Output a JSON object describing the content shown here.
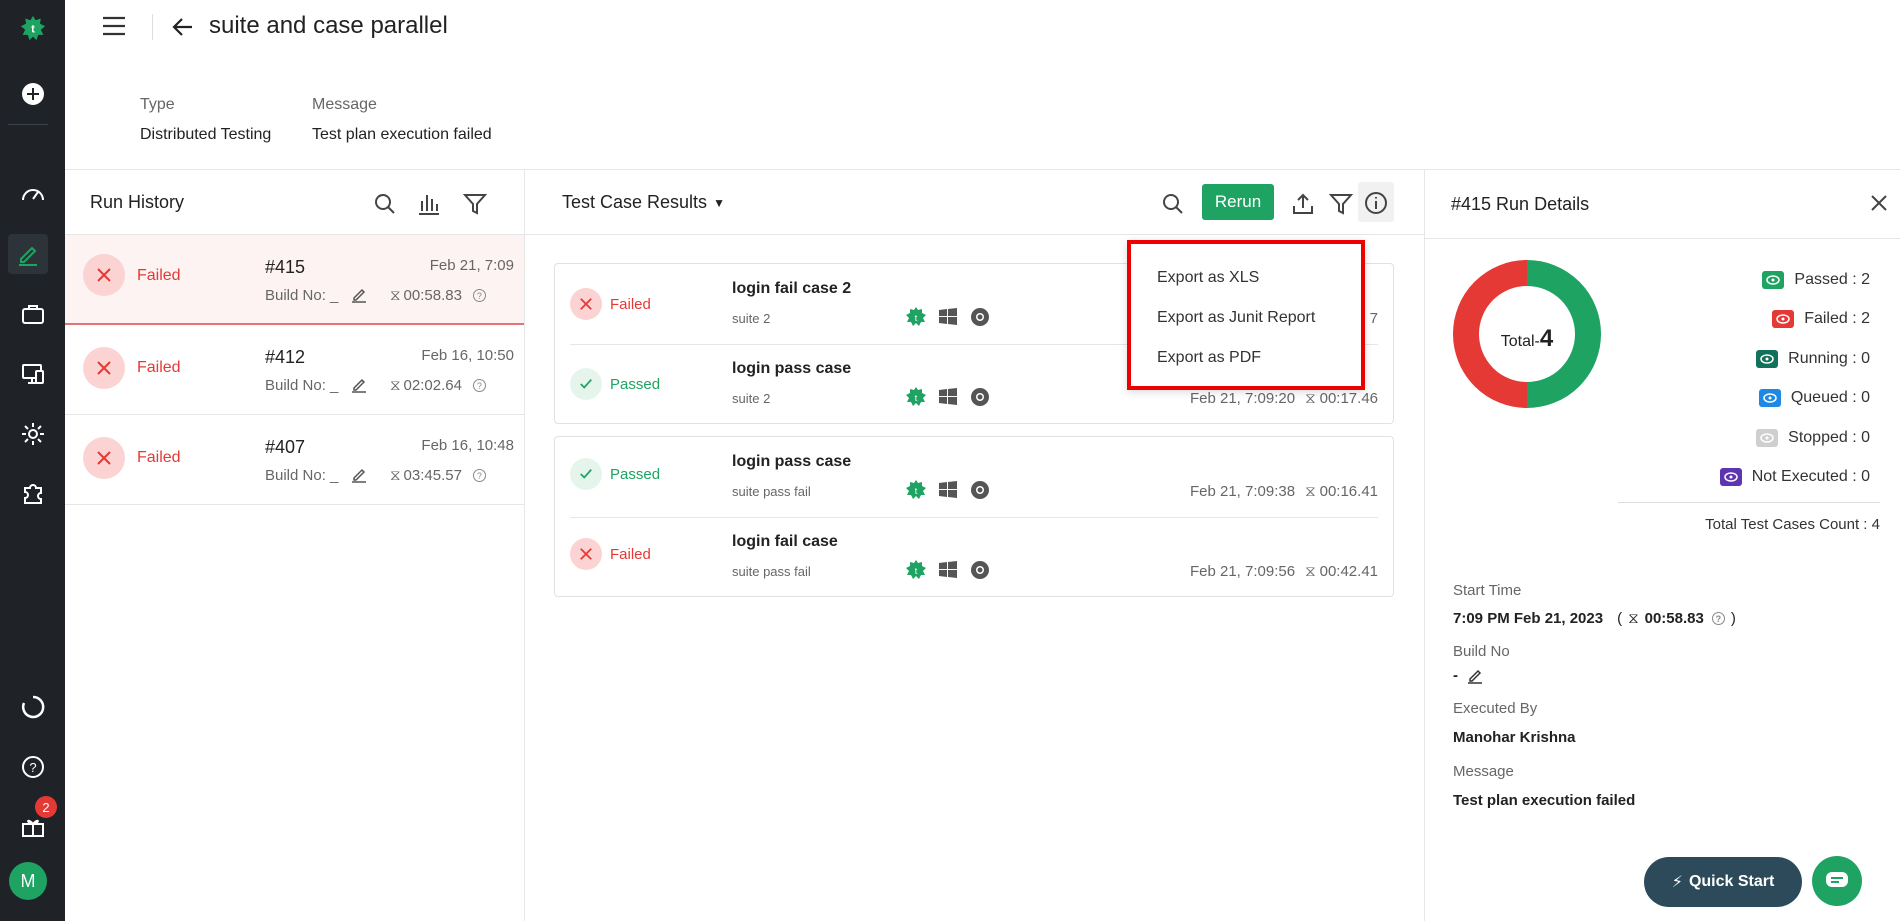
{
  "header": {
    "title": "suite and case parallel",
    "type_label": "Type",
    "type_value": "Distributed Testing",
    "message_label": "Message",
    "message_value": "Test plan execution failed"
  },
  "nav": {
    "notification_count": "2",
    "avatar_initial": "M"
  },
  "run_history": {
    "title": "Run History",
    "runs": [
      {
        "status": "Failed",
        "id": "#415",
        "date": "Feb 21, 7:09",
        "build": "Build No: _",
        "duration": "00:58.83"
      },
      {
        "status": "Failed",
        "id": "#412",
        "date": "Feb 16, 10:50",
        "build": "Build No: _",
        "duration": "02:02.64"
      },
      {
        "status": "Failed",
        "id": "#407",
        "date": "Feb 16, 10:48",
        "build": "Build No: _",
        "duration": "03:45.57"
      }
    ]
  },
  "results": {
    "title": "Test Case Results",
    "rerun_label": "Rerun",
    "groups": [
      {
        "cases": [
          {
            "status": "Failed",
            "name": "login fail case 2",
            "suite": "suite 2",
            "time": "7",
            "duration": ""
          },
          {
            "status": "Passed",
            "name": "login pass case",
            "suite": "suite 2",
            "time": "Feb 21, 7:09:20",
            "duration": "00:17.46"
          }
        ]
      },
      {
        "cases": [
          {
            "status": "Passed",
            "name": "login pass case",
            "suite": "suite pass fail",
            "time": "Feb 21, 7:09:38",
            "duration": "00:16.41"
          },
          {
            "status": "Failed",
            "name": "login fail case",
            "suite": "suite pass fail",
            "time": "Feb 21, 7:09:56",
            "duration": "00:42.41"
          }
        ]
      }
    ]
  },
  "export_menu": {
    "xls": "Export as XLS",
    "junit": "Export as Junit Report",
    "pdf": "Export as PDF"
  },
  "run_details": {
    "title": "#415 Run Details",
    "total_label": "Total",
    "total_sep": "-",
    "total_value": "4",
    "passed_fraction": 0.5,
    "failed_fraction": 0.5,
    "legend": [
      {
        "label": "Passed : 2",
        "color": "#1ea362"
      },
      {
        "label": "Failed : 2",
        "color": "#e53935"
      },
      {
        "label": "Running : 0",
        "color": "#12715a"
      },
      {
        "label": "Queued : 0",
        "color": "#1e88e5"
      },
      {
        "label": "Stopped : 0",
        "color": "#cfcfcf"
      },
      {
        "label": "Not Executed : 0",
        "color": "#5e35b1"
      }
    ],
    "total_count": "Total Test Cases Count : 4",
    "start_time_label": "Start Time",
    "start_time_value": "7:09 PM Feb 21, 2023",
    "start_duration": "00:58.83",
    "build_label": "Build No",
    "build_value": "-",
    "executed_by_label": "Executed By",
    "executed_by_value": "Manohar Krishna",
    "message_label": "Message",
    "message_value": "Test plan execution failed"
  },
  "quick_start_label": "Quick Start",
  "colors": {
    "accent": "#1ea362",
    "fail": "#e53935",
    "nav": "#1f2327"
  }
}
